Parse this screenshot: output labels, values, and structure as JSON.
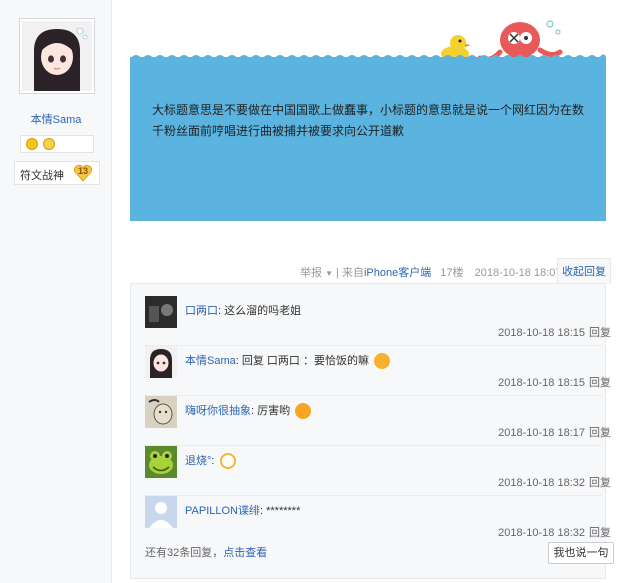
{
  "author": {
    "name": "本情Sama",
    "title_tag": "符文战神",
    "level": "13",
    "avatar_icon": "anime-girl-avatar"
  },
  "post": {
    "text": "大标题意思是不要做在中国国歌上做蠢事，小标题的意思就是说一个网红因为在数千粉丝面前哼唱进行曲被捕并被要求向公开道歉",
    "background_color": "#5bb3e0"
  },
  "tail": {
    "report": "举报",
    "separator": "|",
    "from_prefix": "来自",
    "client": "iPhone客户端",
    "floor": "17楼",
    "time": "2018-10-18 18:07",
    "collapse_reply": "收起回复"
  },
  "comments": [
    {
      "user": "口两口",
      "text": ": 这么溜的吗老姐",
      "time": "2018-10-18 18:15",
      "reply": "回复",
      "emoji": ""
    },
    {
      "user": "本情Sama",
      "text": ": 回复 口两口 ：要恰饭的嘛",
      "time": "2018-10-18 18:15",
      "reply": "回复",
      "emoji": "tongue-emoji"
    },
    {
      "user": "嗨呀你很抽象",
      "text": ": 厉害哟",
      "time": "2018-10-18 18:17",
      "reply": "回复",
      "emoji": "angry-emoji"
    },
    {
      "user": "退烧°",
      "text": ":",
      "time": "2018-10-18 18:32",
      "reply": "回复",
      "emoji": "bubble-emoji"
    },
    {
      "user": "PAPILLON谍绯",
      "text": ": ********",
      "time": "2018-10-18 18:32",
      "reply": "回复",
      "emoji": ""
    }
  ],
  "more": {
    "text": "还有32条回复，",
    "link": "点击查看"
  },
  "say_button": "我也说一句"
}
